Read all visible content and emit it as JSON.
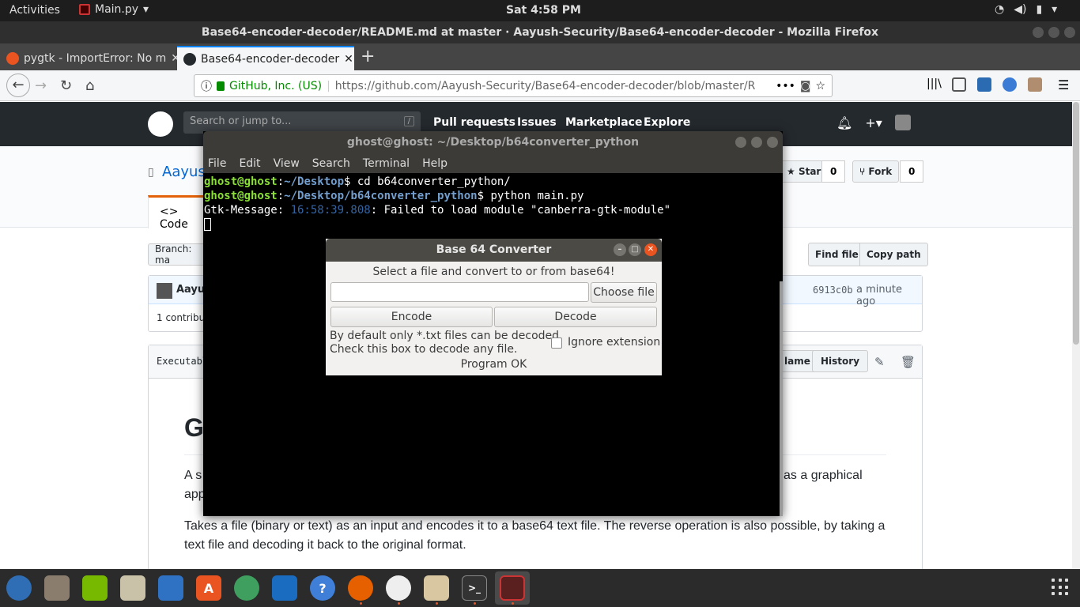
{
  "topbar": {
    "activities": "Activities",
    "app_menu": "Main.py",
    "clock": "Sat  4:58 PM",
    "tray_icons": [
      "wifi-icon",
      "volume-icon",
      "battery-icon",
      "power-icon"
    ]
  },
  "firefox": {
    "window_title": "Base64-encoder-decoder/README.md at master · Aayush-Security/Base64-encoder-decoder - Mozilla Firefox",
    "tabs": [
      {
        "label": "pygtk - ImportError: No m",
        "icon": "askubuntu-icon",
        "color": "#e95420",
        "active": false
      },
      {
        "label": "Base64-encoder-decoder",
        "icon": "github-icon",
        "color": "#24292e",
        "active": true
      }
    ],
    "url_identity": "GitHub, Inc. (US)",
    "url": "https://github.com/Aayush-Security/Base64-encoder-decoder/blob/master/R"
  },
  "github": {
    "search_placeholder": "Search or jump to...",
    "search_shortcut": "/",
    "nav": [
      "Pull requests",
      "Issues",
      "Marketplace",
      "Explore"
    ],
    "repo_owner_partial": "Aayus",
    "code_tab": "<> Code",
    "star_label": "Star",
    "star_count": "0",
    "fork_label": "Fork",
    "fork_count": "0",
    "branch_label": "Branch: ma",
    "find_file": "Find file",
    "copy_path": "Copy path",
    "commit_author_partial": "Aayus",
    "commit_hash": "6913c0b",
    "commit_time": "a minute ago",
    "contributors_partial": "1 contribut",
    "file_info_partial": "Executabl",
    "blame_partial": "lame",
    "history": "History",
    "readme_heading_partial": "G",
    "readme_p1_start": "A s",
    "readme_p1_end": "as a graphical",
    "readme_p1_line2": "app",
    "readme_p2_line1": "Takes a file (binary or text) as an input and encodes it to a base64 text file. The reverse operation is also possible, by taking a",
    "readme_p2_line2": "text file and decoding it back to the original format."
  },
  "terminal": {
    "title": "ghost@ghost: ~/Desktop/b64converter_python",
    "menu": [
      "File",
      "Edit",
      "View",
      "Search",
      "Terminal",
      "Help"
    ],
    "lines": [
      {
        "user": "ghost@ghost",
        "path": "~/Desktop",
        "cmd": "$ cd b64converter_python/"
      },
      {
        "user": "ghost@ghost",
        "path": "~/Desktop/b64converter_python",
        "cmd": "$ python main.py"
      }
    ],
    "msg_prefix": "Gtk-Message",
    "msg_time": "16:58:39.808",
    "msg_text": ": Failed to load module \"canberra-gtk-module\""
  },
  "dialog": {
    "title": "Base 64 Converter",
    "instruction": "Select a file and convert to or from base64!",
    "file_value": "",
    "choose_file": "Choose file",
    "encode": "Encode",
    "decode": "Decode",
    "note_line1": "By default only *.txt files can be decoded.",
    "note_line2": "Check this box to decode any file.",
    "ignore_extension": "Ignore extension",
    "ignore_checked": false,
    "status": "Program OK"
  },
  "dock": {
    "items": [
      "chromium-icon",
      "files-icon",
      "nvidia-icon",
      "disk-icon",
      "writer-icon",
      "software-center-icon",
      "atom-icon",
      "wireshark-icon",
      "help-icon",
      "firefox-icon",
      "text-editor-icon",
      "notes-icon",
      "terminal-icon",
      "python-app-icon"
    ],
    "accent": "#e95420"
  }
}
